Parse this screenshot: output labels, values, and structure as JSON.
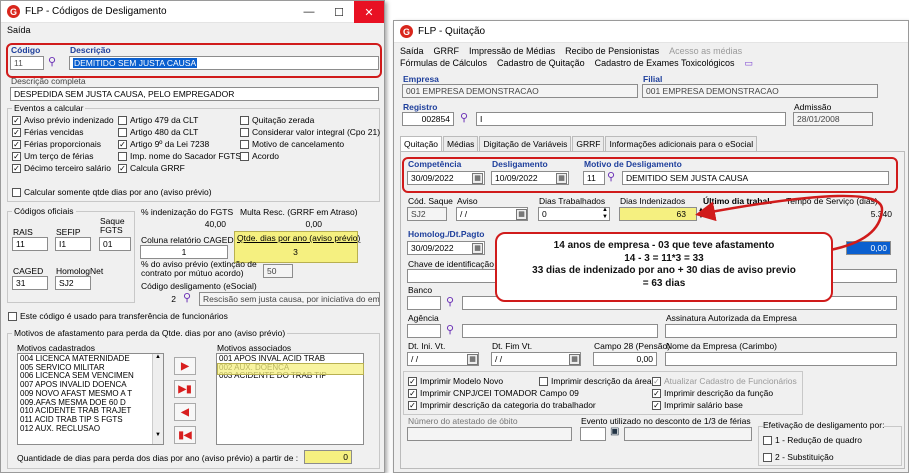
{
  "left": {
    "title": "FLP - Códigos de Desligamento",
    "menu": "Saída",
    "codigo_label": "Código",
    "descricao_label": "Descrição",
    "codigo": "11",
    "descricao": "DEMITIDO SEM JUSTA CAUSA",
    "desc_completa_label": "Descrição completa",
    "desc_completa": "DESPEDIDA SEM JUSTA CAUSA, PELO EMPREGADOR",
    "eventos_label": "Eventos a calcular",
    "col1": [
      "Aviso prévio indenizado",
      "Férias vencidas",
      "Férias proporcionais",
      "Um terço de férias",
      "Décimo terceiro salário"
    ],
    "col1_checked": [
      true,
      true,
      true,
      true,
      true
    ],
    "col2": [
      "Artigo 479 da CLT",
      "Artigo 480 da CLT",
      "Artigo 9º da Lei 7238",
      "Imp. nome do Sacador FGTS",
      "Calcula GRRF"
    ],
    "col2_checked": [
      false,
      false,
      true,
      false,
      true
    ],
    "col3": [
      "Quitação zerada",
      "Considerar valor integral (Cpo 21)",
      "Motivo de cancelamento",
      "Acordo"
    ],
    "calc_somente": "Calcular somente qtde dias por ano (aviso prévio)",
    "codigos_oficiais": "Códigos oficiais",
    "rais_label": "RAIS",
    "rais": "11",
    "sefip_label": "SEFIP",
    "sefip": "I1",
    "saque_label": "Saque FGTS",
    "saque": "01",
    "caged_label": "CAGED",
    "caged": "31",
    "homolognet_label": "HomologNet",
    "homolognet": "SJ2",
    "pct_fgts_label": "% indenização do FGTS",
    "pct_fgts": "40,00",
    "multa_label": "Multa Resc. (GRRF em Atraso)",
    "multa": "0,00",
    "coluna_caged_label": "Coluna relatório CAGED",
    "coluna_caged": "1",
    "qtde_dias_label": "Qtde. dias por ano (aviso prévio)",
    "qtde_dias": "3",
    "pct_aviso_label": "% do aviso prévio (extinção de contrato por mútuo acordo)",
    "pct_aviso": "50",
    "cod_esocial_label": "Código desligamento (eSocial)",
    "cod_esocial": "2",
    "cod_esocial_desc": "Rescisão sem justa causa, por iniciativa do em",
    "usado_transf": "Este código é usado para transferência de funcionários",
    "motivos_label": "Motivos de afastamento para perda da Qtde. dias por ano (aviso prévio)",
    "cadastrados_label": "Motivos cadastrados",
    "associados_label": "Motivos associados",
    "cadastrados": [
      "004 LICENCA MATERNIDADE",
      "005 SERVICO MILITAR",
      "006 LICENCA SEM VENCIMEN",
      "007 APOS INVALID DOENCA",
      "009 NOVO AFAST MESMO A T",
      "009.AFAS MESMA DOE 60 D",
      "010 ACIDENTE TRAB TRAJET",
      "011 ACID TRAB TIP S FGTS",
      "012 AUX. RECLUSAO"
    ],
    "associados": [
      "001 APOS INVAL ACID TRAB",
      "002 AUX. DOENCA",
      "003 ACIDENTE DO TRAB TIP"
    ],
    "quantidade_label": "Quantidade de dias para perda dos dias por ano (aviso prévio) a  partir de :",
    "quantidade": "0"
  },
  "right": {
    "title": "FLP - Quitação",
    "menu": [
      "Saída",
      "GRRF",
      "Impressão de Médias",
      "Recibo de Pensionistas",
      "Acesso as médias",
      "Fórmulas de Cálculos",
      "Cadastro de Quitação",
      "Cadastro de Exames Toxicológicos"
    ],
    "empresa_label": "Empresa",
    "empresa": "001 EMPRESA DEMONSTRACAO",
    "filial_label": "Filial",
    "filial": "001 EMPRESA DEMONSTRACAO",
    "registro_label": "Registro",
    "registro": "002854",
    "registro_nome": "I",
    "admissao_label": "Admissão",
    "admissao": "28/01/2008",
    "tabs": [
      "Quitação",
      "Médias",
      "Digitação de Variáveis",
      "GRRF",
      "Informações adicionais para o eSocial"
    ],
    "competencia_label": "Competência",
    "competencia": "30/09/2022",
    "desligamento_label": "Desligamento",
    "desligamento": "10/09/2022",
    "motivo_label": "Motivo de Desligamento",
    "motivo_cod": "11",
    "motivo": "DEMITIDO SEM JUSTA CAUSA",
    "cod_saque_label": "Cód. Saque",
    "cod_saque": "SJ2",
    "aviso_label": "Aviso",
    "aviso": " / /",
    "dias_trab_label": "Dias Trabalhados",
    "dias_trab": "0",
    "dias_ind_label": "Dias Indenizados",
    "dias_ind": "63",
    "ultimo_dia_label": "Último dia trabal.",
    "tempo_servico_label": "Tempo de Serviço (dias)",
    "tempo_servico": "5.340",
    "homolog_label": "Homolog./Dt.Pagto",
    "homolog": "30/09/2022",
    "chave_label": "Chave de identificação",
    "banco_label": "Banco",
    "agencia_label": "Agência",
    "assinatura_label": "Assinatura Autorizada da Empresa",
    "dt_ini_label": "Dt. Ini. Vt.",
    "dt_ini": " / /",
    "dt_fim_label": "Dt. Fim Vt.",
    "dt_fim": " / /",
    "campo28_label": "Campo 28 (Pensão)",
    "campo28": "0,00",
    "nome_empresa_label": "Nome da Empresa (Carimbo)",
    "checks": [
      {
        "label": "Imprimir Modelo Novo",
        "checked": true,
        "disabled": false
      },
      {
        "label": "Imprimir descrição da área",
        "checked": false,
        "disabled": false
      },
      {
        "label": "Atualizar Cadastro de Funcionários",
        "checked": true,
        "disabled": true
      },
      {
        "label": "Imprimir CNPJ/CEI TOMADOR Campo 09",
        "checked": true,
        "disabled": false
      },
      {
        "label": "Imprimir descrição da função",
        "checked": true,
        "disabled": false
      },
      {
        "label": "Imprimir descrição da categoria do trabalhador",
        "checked": true,
        "disabled": false
      },
      {
        "label": "Imprimir salário base",
        "checked": true,
        "disabled": false
      }
    ],
    "atestado_label": "Número do atestado de óbito",
    "evento_label": "Evento utilizado no desconto de 1/3 de férias",
    "efetivacao_label": "Efetivação de desligamento por:",
    "efetivacao": [
      "1 - Redução de quadro",
      "2 - Substituição"
    ],
    "zero_val": "0,00"
  },
  "callout": {
    "lines": [
      "14 anos de empresa - 03 que teve afastamento",
      "14 - 3 = 11*3 = 33",
      "33 dias de indenizado por ano + 30 dias de aviso previo",
      "= 63 dias"
    ]
  },
  "colors": {
    "highlight_red": "#d01b1b",
    "highlight_yellow": "#f5f080",
    "selection_blue": "#0a5fcf"
  }
}
